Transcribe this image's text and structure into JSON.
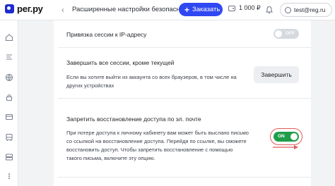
{
  "header": {
    "logo_text": "рег.ру",
    "back_icon": "chevron-left-icon",
    "title": "Расширенные настройки безопасности",
    "order_button": {
      "plus": "+",
      "label": "Заказать"
    },
    "balance": "1 000 ₽",
    "account_email": "test@reg.ru"
  },
  "sidebar": {
    "icons": [
      "home-icon",
      "document-icon",
      "globe-icon",
      "lock-icon",
      "card-icon",
      "bus-icon",
      "server-icon",
      "more-icon"
    ]
  },
  "settings": {
    "ip_binding": {
      "title": "Привязка сессии к IP-адресу",
      "toggle_label": "OFF",
      "enabled": false
    },
    "end_sessions": {
      "title": "Завершить все сессии, кроме текущей",
      "description_1": "Если вы хотите выйти из аккаунта со всех браузеров, в том числе на",
      "description_2": "других устройствах",
      "button_label": "Завершить"
    },
    "email_recovery": {
      "title": "Запретить восстановление доступа по эл. почте",
      "description_1": "При потере доступа к личному кабинету вам может быть выслано письмо",
      "description_2": "со ссылкой на восстановление доступа. Перейдя по ссылке, вы сможете",
      "description_3": "восстановить доступ. Чтобы запретить восстановление с помощью",
      "description_4": "такого письма, включите эту опцию.",
      "toggle_label": "ON",
      "enabled": true
    }
  },
  "colors": {
    "accent": "#2f48f1",
    "toggle_on": "#1f9d4a",
    "annotation": "#e05a5a"
  }
}
